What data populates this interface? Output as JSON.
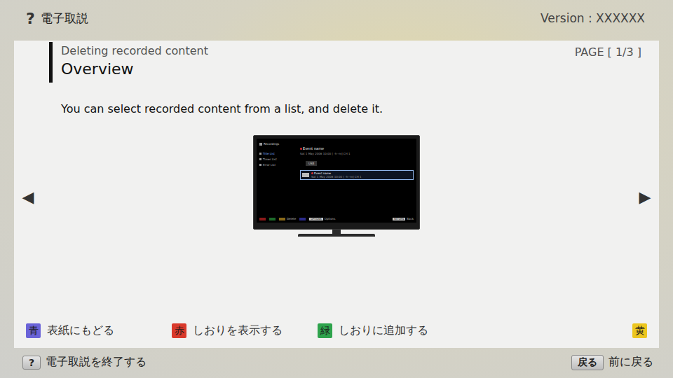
{
  "header": {
    "help_icon": "?",
    "title": "電子取説",
    "version": "Version : XXXXXX"
  },
  "page": {
    "section": "Deleting recorded content",
    "title": "Overview",
    "page": "PAGE [ 1/3 ]",
    "body": "You can select recorded content from a list, and delete it."
  },
  "nav": {
    "prev": "◀",
    "next": "▶"
  },
  "tv_screen": {
    "menu_title": "Recordings",
    "menu": [
      {
        "label": "Title List",
        "selected": true
      },
      {
        "label": "Timer List",
        "selected": false
      },
      {
        "label": "Error List",
        "selected": false
      }
    ],
    "event_title": "Event name",
    "event_info": "Sat 1 May 2006 10:00 [ -h--m] CH 1",
    "button": "USB",
    "rows": [
      {
        "title": "Event name",
        "info": "Sat 1 May 2006 10:00 [ -h--m] CH 1",
        "selected": true
      }
    ],
    "keys": [
      {
        "label": "",
        "color": "#8b1a1a"
      },
      {
        "label": "",
        "color": "#1d6b2a"
      },
      {
        "label": "Delete",
        "color": "#8a6a1a"
      },
      {
        "label": "",
        "color": "#2a2a8a"
      }
    ],
    "options_key": "OPTIONS",
    "options": "Options",
    "back_key": "RETURN",
    "back": "Back"
  },
  "color_keys": [
    {
      "key": "青",
      "label": "表紙にもどる",
      "color": "#6a63d8"
    },
    {
      "key": "赤",
      "label": "しおりを表示する",
      "color": "#d9392b"
    },
    {
      "key": "緑",
      "label": "しおりに追加する",
      "color": "#2ea34c"
    },
    {
      "key": "黄",
      "label": "",
      "color": "#ecc61f"
    }
  ],
  "footer": {
    "exit_key": "?",
    "exit_label": "電子取説を終了する",
    "back_key": "戻る",
    "back_label": "前に戻る"
  }
}
